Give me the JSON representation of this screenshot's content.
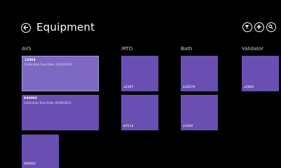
{
  "header": {
    "title": "Equipment",
    "back_icon": "back-arrow-icon",
    "actions": [
      {
        "name": "filter-button",
        "icon": "filter-icon"
      },
      {
        "name": "add-button",
        "icon": "plus-icon"
      },
      {
        "name": "search-button",
        "icon": "search-icon"
      }
    ]
  },
  "columns": {
    "avs": "AVS",
    "irtd": "IRTD",
    "bath": "Bath",
    "validator": "Validator"
  },
  "tiles": {
    "avs": [
      {
        "title": "12464",
        "subtitle": "Calibration Due Date: 10/12/2014"
      },
      {
        "title": "K90002",
        "subtitle": "Calibration Due Date: 03/08/2015"
      },
      {
        "id": "K90001"
      }
    ],
    "irtd": [
      {
        "id": "a2387"
      },
      {
        "id": "87514"
      }
    ],
    "bath": [
      {
        "id": "b32674"
      },
      {
        "id": "23456"
      }
    ],
    "validator": [
      {
        "id": "a5800"
      }
    ]
  },
  "colors": {
    "background": "#000000",
    "tile": "#6a4fb2",
    "tile_selected": "#7d68c2",
    "text": "#ffffff"
  }
}
